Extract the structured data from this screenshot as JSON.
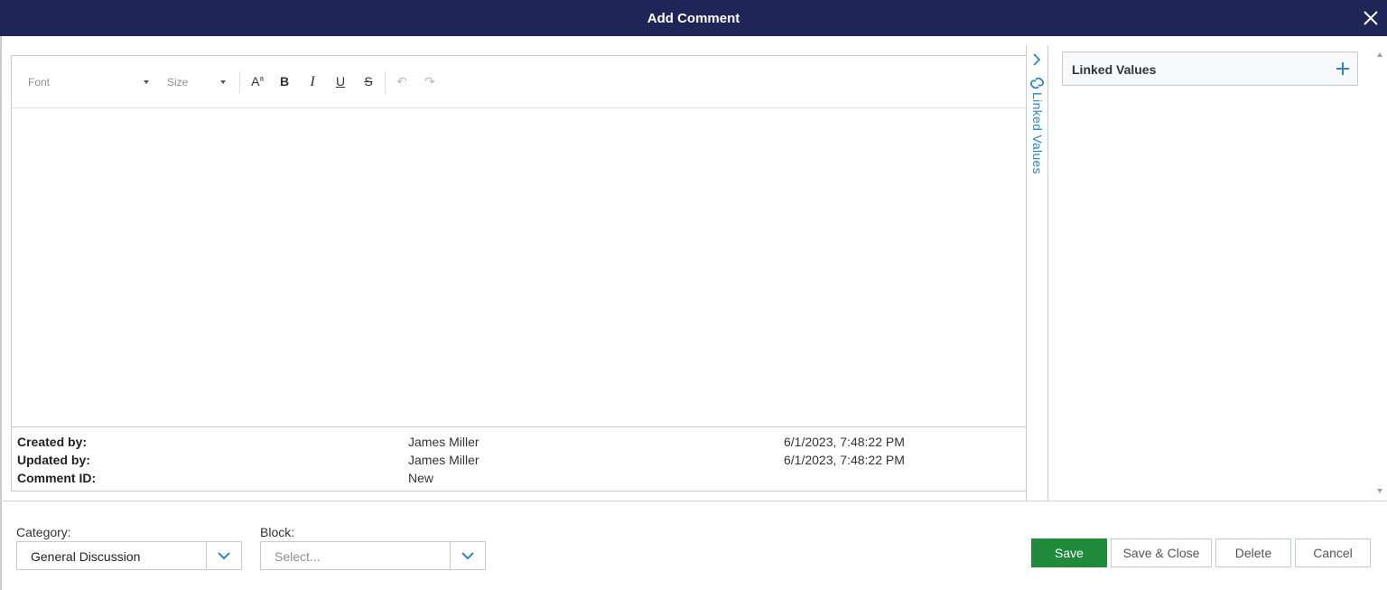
{
  "dialog": {
    "title": "Add Comment"
  },
  "toolbar": {
    "font_placeholder": "Font",
    "size_placeholder": "Size",
    "font_color_glyph": "A",
    "bold_glyph": "B",
    "italic_glyph": "I",
    "underline_glyph": "U",
    "strike_glyph": "S",
    "undo_glyph": "↶",
    "redo_glyph": "↷"
  },
  "meta": {
    "created_label": "Created by:",
    "created_by": "James Miller",
    "created_at": "6/1/2023, 7:48:22 PM",
    "updated_label": "Updated by:",
    "updated_by": "James Miller",
    "updated_at": "6/1/2023, 7:48:22 PM",
    "id_label": "Comment ID:",
    "id_value": "New"
  },
  "side_tab": {
    "label": "Linked Values"
  },
  "linked_panel": {
    "title": "Linked Values"
  },
  "footer": {
    "category_label": "Category:",
    "category_value": "General Discussion",
    "block_label": "Block:",
    "block_placeholder": "Select...",
    "save": "Save",
    "save_close": "Save & Close",
    "delete": "Delete",
    "cancel": "Cancel"
  },
  "colors": {
    "title_bar": "#1f2657",
    "accent_blue": "#2d86c6",
    "save_green": "#1f8a3a"
  },
  "icons": [
    "close-icon",
    "chevron-right-icon",
    "link-icon",
    "plus-icon",
    "chevron-down-icon"
  ]
}
